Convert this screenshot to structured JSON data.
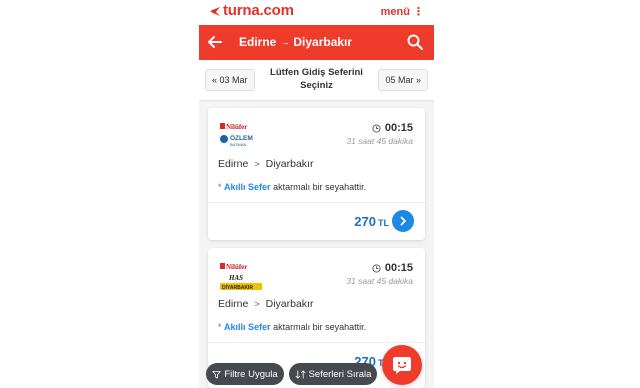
{
  "header": {
    "logo_text": "turna.com",
    "menu_label": "menü ⋮"
  },
  "route_bar": {
    "origin": "Edirne",
    "arrow": "→",
    "destination": "Diyarbakır"
  },
  "date_bar": {
    "prev_label": "« 03 Mar",
    "center_label": "Lütfen Gidiş Seferini Seçiniz",
    "next_label": "05 Mar »"
  },
  "trips": [
    {
      "logo_top": "Nilüfer",
      "logo_bottom": "ÖZLEM",
      "logo_sub": "BATMAN",
      "time": "00:15",
      "duration": "31 saat 45 dakika",
      "origin": "Edirne",
      "separator": ">",
      "destination": "Diyarbakır",
      "note_star": "*",
      "note_highlight": "Akıllı Sefer",
      "note_rest": "aktarmalı bir seyahattir.",
      "price": "270",
      "currency": "TL"
    },
    {
      "logo_top": "Nilüfer",
      "logo_bottom": "HAS",
      "logo_sub": "DİYARBAKIR",
      "time": "00:15",
      "duration": "31 saat 45 dakika",
      "origin": "Edirne",
      "separator": ">",
      "destination": "Diyarbakır",
      "note_star": "*",
      "note_highlight": "Akıllı Sefer",
      "note_rest": "aktarmalı bir seyahattir.",
      "price": "270",
      "currency": "TL"
    }
  ],
  "bottom_bar": {
    "filter_label": "Filtre Uygula",
    "sort_label": "Seferleri Sırala"
  },
  "colors": {
    "brand_red": "#ee3b2b",
    "link_blue": "#1e88e5",
    "price_blue": "#1e6fc7"
  }
}
